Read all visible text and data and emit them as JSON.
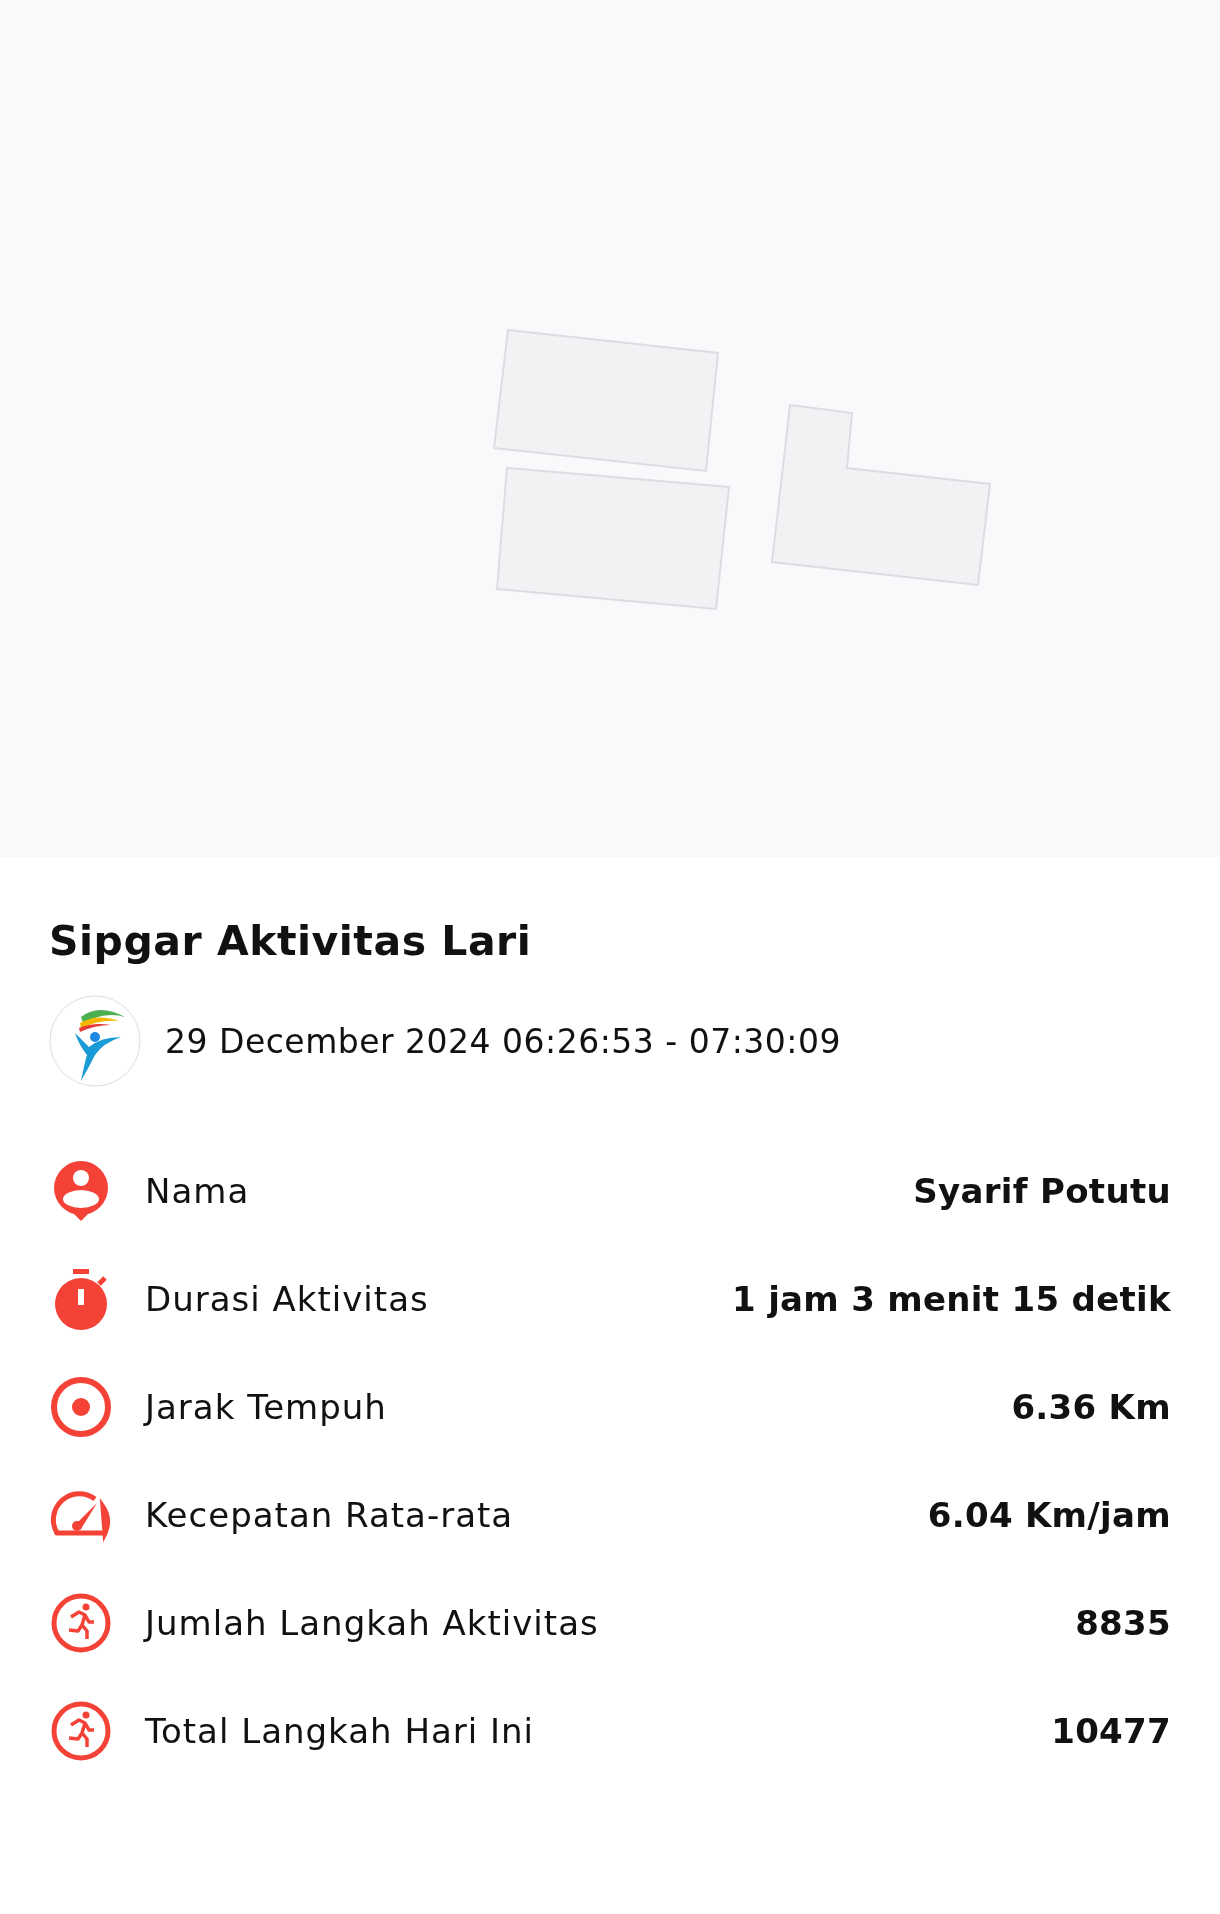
{
  "title": "Sipgar Aktivitas Lari",
  "session": {
    "time_range": "29 December 2024 06:26:53 - 07:30:09"
  },
  "stats": [
    {
      "kind": "person",
      "label": "Nama",
      "value": "Syarif Potutu"
    },
    {
      "kind": "stopwatch",
      "label": "Durasi Aktivitas",
      "value": "1 jam 3 menit 15 detik"
    },
    {
      "kind": "target",
      "label": "Jarak Tempuh",
      "value": "6.36 Km"
    },
    {
      "kind": "speedometer",
      "label": "Kecepatan Rata-rata",
      "value": "6.04 Km/jam"
    },
    {
      "kind": "runner",
      "label": "Jumlah Langkah Aktivitas",
      "value": "8835"
    },
    {
      "kind": "runner",
      "label": "Total Langkah Hari Ini",
      "value": "10477"
    }
  ]
}
